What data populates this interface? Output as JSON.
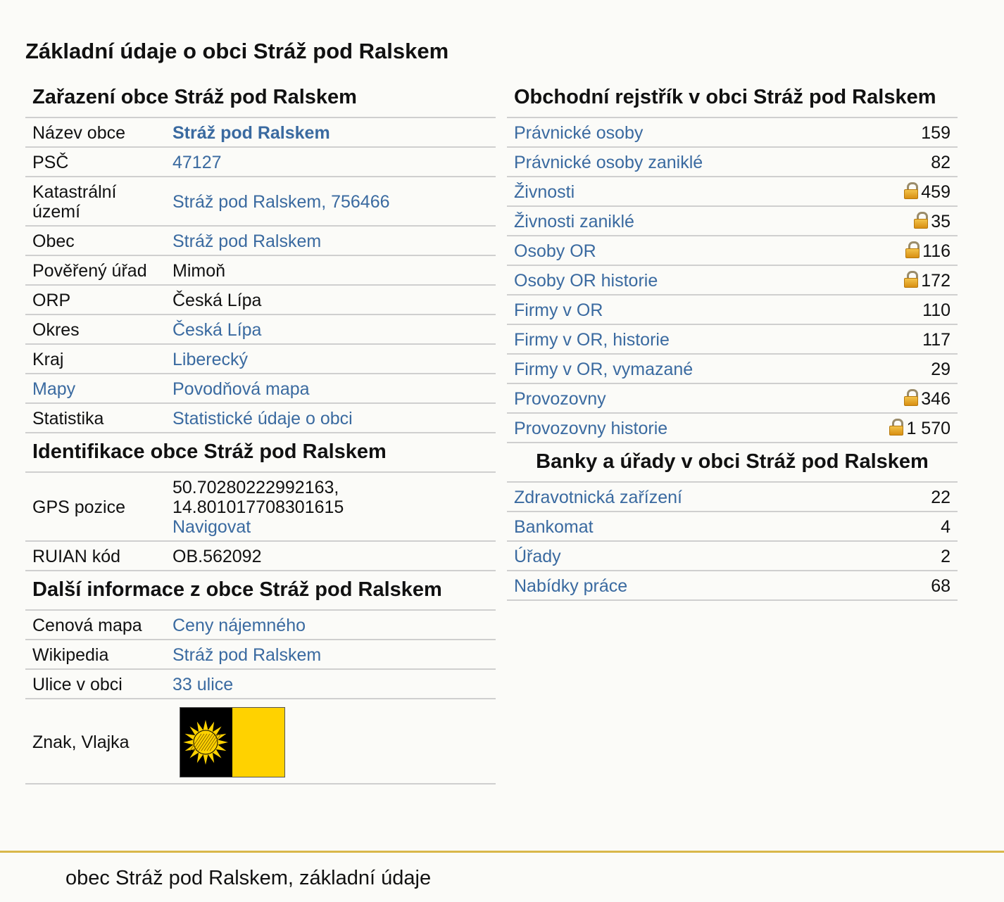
{
  "page": {
    "title": "Základní údaje o obci Stráž pod Ralskem"
  },
  "zarazeni": {
    "heading": "Zařazení obce Stráž pod Ralskem",
    "rows": [
      {
        "label": "Název obce",
        "value": "Stráž pod Ralskem"
      },
      {
        "label": "PSČ",
        "value": "47127"
      },
      {
        "label": "Katastrální území",
        "value": "Stráž pod Ralskem, 756466"
      },
      {
        "label": "Obec",
        "value": "Stráž pod Ralskem"
      },
      {
        "label": "Pověřený úřad",
        "value": "Mimoň"
      },
      {
        "label": "ORP",
        "value": "Česká Lípa"
      },
      {
        "label": "Okres",
        "value": "Česká Lípa"
      },
      {
        "label": "Kraj",
        "value": "Liberecký"
      },
      {
        "label": "Mapy",
        "value": "Povodňová mapa"
      },
      {
        "label": "Statistika",
        "value": "Statistické údaje o obci"
      }
    ]
  },
  "identifikace": {
    "heading": "Identifikace obce Stráž pod Ralskem",
    "gps_label": "GPS pozice",
    "gps_lat": "50.70280222992163,",
    "gps_lon": "14.801017708301615",
    "navigate": "Navigovat",
    "ruian_label": "RUIAN kód",
    "ruian_value": "OB.562092"
  },
  "dalsi": {
    "heading": "Další informace z obce Stráž pod Ralskem",
    "rows": [
      {
        "label": "Cenová mapa",
        "value": "Ceny nájemného"
      },
      {
        "label": "Wikipedia",
        "value": "Stráž pod Ralskem"
      },
      {
        "label": "Ulice v obci",
        "value": "33 ulice"
      }
    ],
    "emblem_label": "Znak, Vlajka",
    "flag_colors": {
      "left": "#000000",
      "right": "#ffd200",
      "sun": "#ffd200"
    }
  },
  "rejstrik": {
    "heading": "Obchodní rejstřík v obci Stráž pod Ralskem",
    "rows": [
      {
        "label": "Právnické osoby",
        "value": "159",
        "locked": false
      },
      {
        "label": "Právnické osoby zaniklé",
        "value": "82",
        "locked": false
      },
      {
        "label": "Živnosti",
        "value": "459",
        "locked": true
      },
      {
        "label": "Živnosti zaniklé",
        "value": "35",
        "locked": true
      },
      {
        "label": "Osoby OR",
        "value": "116",
        "locked": true
      },
      {
        "label": "Osoby OR historie",
        "value": "172",
        "locked": true
      },
      {
        "label": "Firmy v OR",
        "value": "110",
        "locked": false
      },
      {
        "label": "Firmy v OR, historie",
        "value": "117",
        "locked": false
      },
      {
        "label": "Firmy v OR, vymazané",
        "value": "29",
        "locked": false
      },
      {
        "label": "Provozovny",
        "value": "346",
        "locked": true
      },
      {
        "label": "Provozovny historie",
        "value": "1 570",
        "locked": true
      }
    ]
  },
  "banky": {
    "heading": "Banky a úřady v obci Stráž pod Ralskem",
    "rows": [
      {
        "label": "Zdravotnická zařízení",
        "value": "22"
      },
      {
        "label": "Bankomat",
        "value": "4"
      },
      {
        "label": "Úřady",
        "value": "2"
      },
      {
        "label": "Nabídky práce",
        "value": "68"
      }
    ]
  },
  "footer": {
    "text": "obec Stráž pod Ralskem, základní údaje"
  },
  "colors": {
    "link": "#3a6aa0",
    "footer_rule": "#d9b84a",
    "lock": "#e6a520"
  }
}
